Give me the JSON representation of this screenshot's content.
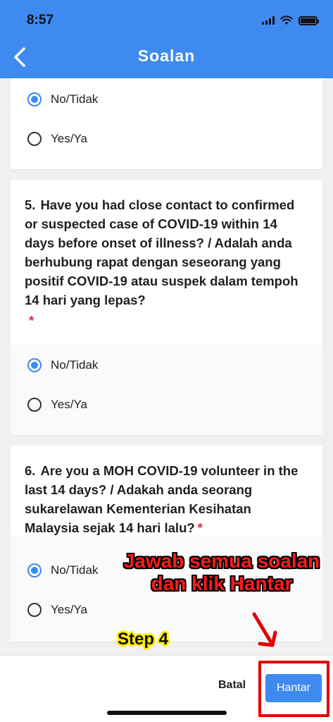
{
  "status_bar": {
    "time": "8:57"
  },
  "header": {
    "title": "Soalan"
  },
  "questions": [
    {
      "number": "",
      "text": "",
      "options": [
        {
          "label": "No/Tidak",
          "checked": true
        },
        {
          "label": "Yes/Ya",
          "checked": false
        }
      ]
    },
    {
      "number": "5.",
      "text": "Have you had close contact to confirmed or suspected case of COVID-19 within 14 days before onset of illness? / Adalah anda berhubung rapat dengan seseorang yang positif COVID-19 atau suspek dalam tempoh 14 hari yang lepas?",
      "required_mark": "*",
      "options": [
        {
          "label": "No/Tidak",
          "checked": true
        },
        {
          "label": "Yes/Ya",
          "checked": false
        }
      ]
    },
    {
      "number": "6.",
      "text": "Are you a MOH COVID-19 volunteer in the last 14 days? / Adakah anda seorang sukarelawan Kementerian Kesihatan Malaysia sejak 14 hari lalu?",
      "required_mark": "*",
      "options": [
        {
          "label": "No/Tidak",
          "checked": true
        },
        {
          "label": "Yes/Ya",
          "checked": false
        }
      ]
    }
  ],
  "footer": {
    "cancel_label": "Batal",
    "submit_label": "Hantar"
  },
  "annotations": {
    "instruction_line1": "Jawab semua soalan",
    "instruction_line2": "dan klik Hantar",
    "step": "Step 4"
  },
  "colors": {
    "accent": "#3e8af0",
    "required": "#e8234a",
    "annotation_red": "#ff1a1a",
    "annotation_yellow": "#ffef00"
  }
}
